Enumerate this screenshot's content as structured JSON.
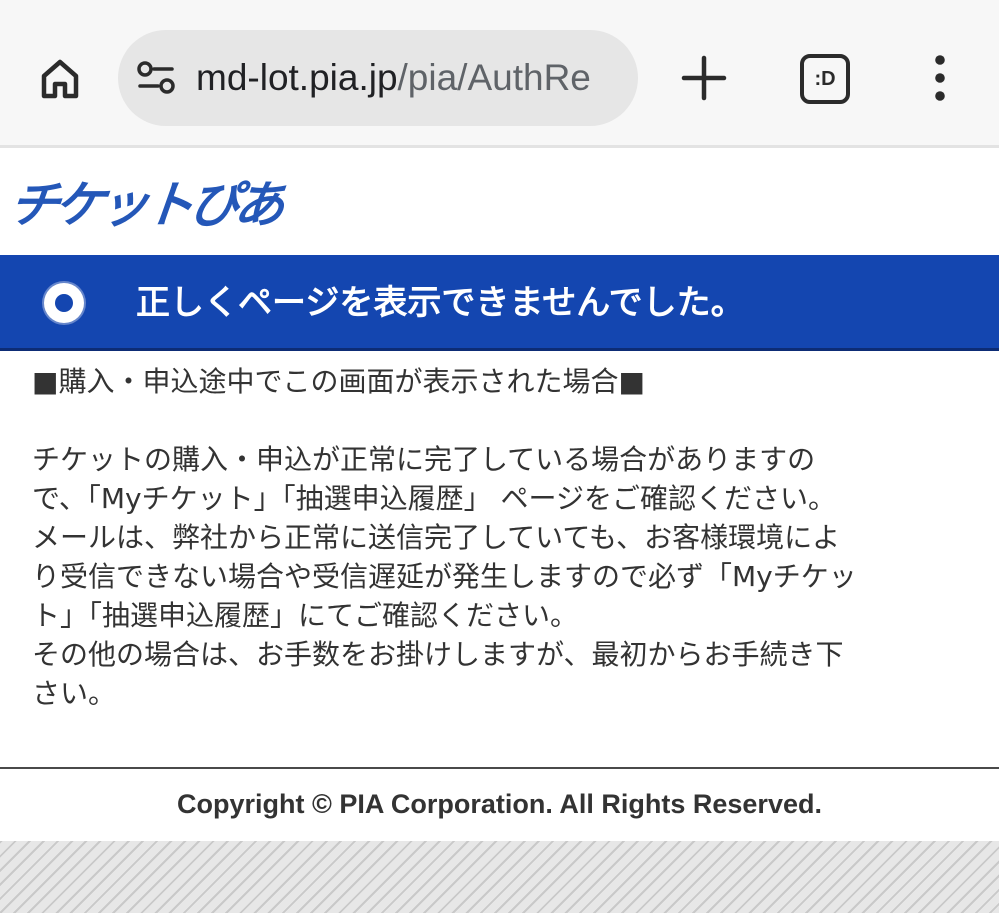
{
  "browser": {
    "home_icon": "home-icon",
    "site_settings_icon": "tune-icon",
    "url_host": "md-lot.pia.jp",
    "url_path": "/pia/AuthRe",
    "new_tab_icon": "plus-icon",
    "tab_switcher_label": ":D",
    "menu_icon": "more-vert-icon"
  },
  "page": {
    "logo_text": "チケットぴあ",
    "brand_color": "#1446b0",
    "error_title": "正しくページを表示できませんでした。",
    "section_heading": "■購入・申込途中でこの画面が表示された場合■",
    "body_lines": [
      "チケットの購入・申込が正常に完了している場合がありますの",
      "で、「Myチケット」「抽選申込履歴」 ページをご確認ください。",
      "メールは、弊社から正常に送信完了していても、お客様環境によ",
      "り受信できない場合や受信遅延が発生しますので必ず「Myチケッ",
      "ト」「抽選申込履歴」にてご確認ください。",
      "その他の場合は、お手数をお掛けしますが、最初からお手続き下",
      "さい。"
    ],
    "copyright": "Copyright © PIA Corporation. All Rights Reserved."
  }
}
